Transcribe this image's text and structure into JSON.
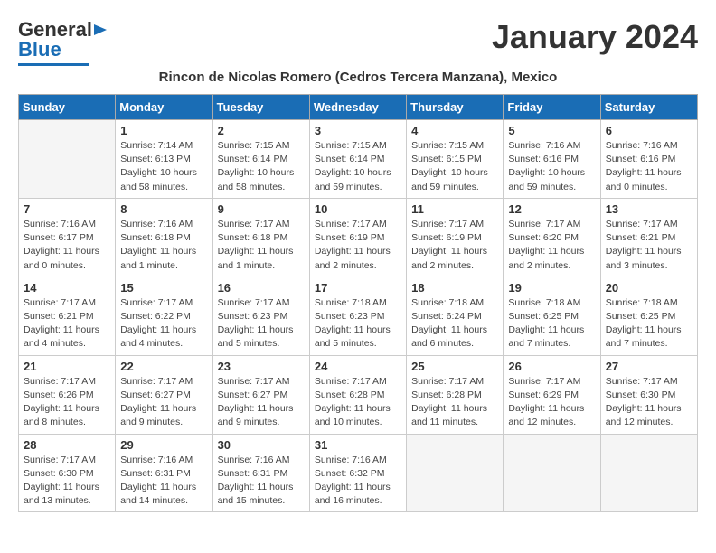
{
  "header": {
    "logo_general": "General",
    "logo_blue": "Blue",
    "month_title": "January 2024",
    "location": "Rincon de Nicolas Romero (Cedros Tercera Manzana), Mexico"
  },
  "days_of_week": [
    "Sunday",
    "Monday",
    "Tuesday",
    "Wednesday",
    "Thursday",
    "Friday",
    "Saturday"
  ],
  "weeks": [
    [
      {
        "num": "",
        "info": ""
      },
      {
        "num": "1",
        "info": "Sunrise: 7:14 AM\nSunset: 6:13 PM\nDaylight: 10 hours\nand 58 minutes."
      },
      {
        "num": "2",
        "info": "Sunrise: 7:15 AM\nSunset: 6:14 PM\nDaylight: 10 hours\nand 58 minutes."
      },
      {
        "num": "3",
        "info": "Sunrise: 7:15 AM\nSunset: 6:14 PM\nDaylight: 10 hours\nand 59 minutes."
      },
      {
        "num": "4",
        "info": "Sunrise: 7:15 AM\nSunset: 6:15 PM\nDaylight: 10 hours\nand 59 minutes."
      },
      {
        "num": "5",
        "info": "Sunrise: 7:16 AM\nSunset: 6:16 PM\nDaylight: 10 hours\nand 59 minutes."
      },
      {
        "num": "6",
        "info": "Sunrise: 7:16 AM\nSunset: 6:16 PM\nDaylight: 11 hours\nand 0 minutes."
      }
    ],
    [
      {
        "num": "7",
        "info": "Sunrise: 7:16 AM\nSunset: 6:17 PM\nDaylight: 11 hours\nand 0 minutes."
      },
      {
        "num": "8",
        "info": "Sunrise: 7:16 AM\nSunset: 6:18 PM\nDaylight: 11 hours\nand 1 minute."
      },
      {
        "num": "9",
        "info": "Sunrise: 7:17 AM\nSunset: 6:18 PM\nDaylight: 11 hours\nand 1 minute."
      },
      {
        "num": "10",
        "info": "Sunrise: 7:17 AM\nSunset: 6:19 PM\nDaylight: 11 hours\nand 2 minutes."
      },
      {
        "num": "11",
        "info": "Sunrise: 7:17 AM\nSunset: 6:19 PM\nDaylight: 11 hours\nand 2 minutes."
      },
      {
        "num": "12",
        "info": "Sunrise: 7:17 AM\nSunset: 6:20 PM\nDaylight: 11 hours\nand 2 minutes."
      },
      {
        "num": "13",
        "info": "Sunrise: 7:17 AM\nSunset: 6:21 PM\nDaylight: 11 hours\nand 3 minutes."
      }
    ],
    [
      {
        "num": "14",
        "info": "Sunrise: 7:17 AM\nSunset: 6:21 PM\nDaylight: 11 hours\nand 4 minutes."
      },
      {
        "num": "15",
        "info": "Sunrise: 7:17 AM\nSunset: 6:22 PM\nDaylight: 11 hours\nand 4 minutes."
      },
      {
        "num": "16",
        "info": "Sunrise: 7:17 AM\nSunset: 6:23 PM\nDaylight: 11 hours\nand 5 minutes."
      },
      {
        "num": "17",
        "info": "Sunrise: 7:18 AM\nSunset: 6:23 PM\nDaylight: 11 hours\nand 5 minutes."
      },
      {
        "num": "18",
        "info": "Sunrise: 7:18 AM\nSunset: 6:24 PM\nDaylight: 11 hours\nand 6 minutes."
      },
      {
        "num": "19",
        "info": "Sunrise: 7:18 AM\nSunset: 6:25 PM\nDaylight: 11 hours\nand 7 minutes."
      },
      {
        "num": "20",
        "info": "Sunrise: 7:18 AM\nSunset: 6:25 PM\nDaylight: 11 hours\nand 7 minutes."
      }
    ],
    [
      {
        "num": "21",
        "info": "Sunrise: 7:17 AM\nSunset: 6:26 PM\nDaylight: 11 hours\nand 8 minutes."
      },
      {
        "num": "22",
        "info": "Sunrise: 7:17 AM\nSunset: 6:27 PM\nDaylight: 11 hours\nand 9 minutes."
      },
      {
        "num": "23",
        "info": "Sunrise: 7:17 AM\nSunset: 6:27 PM\nDaylight: 11 hours\nand 9 minutes."
      },
      {
        "num": "24",
        "info": "Sunrise: 7:17 AM\nSunset: 6:28 PM\nDaylight: 11 hours\nand 10 minutes."
      },
      {
        "num": "25",
        "info": "Sunrise: 7:17 AM\nSunset: 6:28 PM\nDaylight: 11 hours\nand 11 minutes."
      },
      {
        "num": "26",
        "info": "Sunrise: 7:17 AM\nSunset: 6:29 PM\nDaylight: 11 hours\nand 12 minutes."
      },
      {
        "num": "27",
        "info": "Sunrise: 7:17 AM\nSunset: 6:30 PM\nDaylight: 11 hours\nand 12 minutes."
      }
    ],
    [
      {
        "num": "28",
        "info": "Sunrise: 7:17 AM\nSunset: 6:30 PM\nDaylight: 11 hours\nand 13 minutes."
      },
      {
        "num": "29",
        "info": "Sunrise: 7:16 AM\nSunset: 6:31 PM\nDaylight: 11 hours\nand 14 minutes."
      },
      {
        "num": "30",
        "info": "Sunrise: 7:16 AM\nSunset: 6:31 PM\nDaylight: 11 hours\nand 15 minutes."
      },
      {
        "num": "31",
        "info": "Sunrise: 7:16 AM\nSunset: 6:32 PM\nDaylight: 11 hours\nand 16 minutes."
      },
      {
        "num": "",
        "info": ""
      },
      {
        "num": "",
        "info": ""
      },
      {
        "num": "",
        "info": ""
      }
    ]
  ]
}
